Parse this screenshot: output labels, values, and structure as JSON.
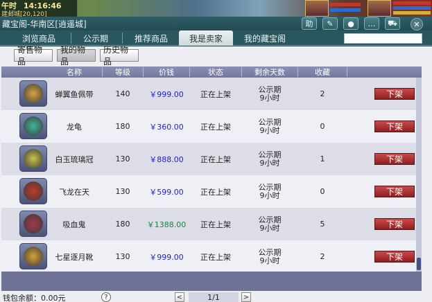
{
  "game_hud": {
    "time_prefix": "午时",
    "time": "14:16:46",
    "date_text": "建邺城[20,120]"
  },
  "window": {
    "title": "藏宝阁-华南区[逍遥城]",
    "title_buttons": [
      {
        "name": "assistant-button",
        "label": "助"
      },
      {
        "name": "edit-icon",
        "label": "✎"
      },
      {
        "name": "record-icon",
        "label": "●"
      },
      {
        "name": "chat-icon",
        "label": "…"
      },
      {
        "name": "cart-icon",
        "label": "⛟"
      }
    ],
    "close_label": "✕"
  },
  "tabs": [
    {
      "label": "浏览商品",
      "active": false
    },
    {
      "label": "公示期",
      "active": false
    },
    {
      "label": "推荐商品",
      "active": false
    },
    {
      "label": "我是卖家",
      "active": true
    },
    {
      "label": "我的藏宝阁",
      "active": false
    }
  ],
  "search": {
    "value": "",
    "placeholder": ""
  },
  "subtabs": [
    {
      "label": "寄售物品",
      "active": false
    },
    {
      "label": "我的物品",
      "active": true
    },
    {
      "label": "历史物品",
      "active": false
    }
  ],
  "table": {
    "columns": [
      "名称",
      "等级",
      "价钱",
      "状态",
      "剩余天数",
      "收藏"
    ],
    "rows": [
      {
        "name": "蝉翼鱼佩带",
        "level": "140",
        "price": "￥999.00",
        "status": "正在上架",
        "days_line1": "公示期",
        "days_line2": "9小时",
        "favorites": "2",
        "action": "下架",
        "icon": "belt-icon",
        "icon_color": "#d9a441"
      },
      {
        "name": "龙龟",
        "level": "180",
        "price": "￥360.00",
        "status": "正在上架",
        "days_line1": "公示期",
        "days_line2": "9小时",
        "favorites": "0",
        "action": "下架",
        "icon": "dragon-turtle-icon",
        "icon_color": "#3fb59a"
      },
      {
        "name": "白玉琉璃冠",
        "level": "130",
        "price": "￥888.00",
        "status": "正在上架",
        "days_line1": "公示期",
        "days_line2": "9小时",
        "favorites": "1",
        "action": "下架",
        "icon": "crown-icon",
        "icon_color": "#c8c24a"
      },
      {
        "name": "飞龙在天",
        "level": "130",
        "price": "￥599.00",
        "status": "正在上架",
        "days_line1": "公示期",
        "days_line2": "9小时",
        "favorites": "0",
        "action": "下架",
        "icon": "spear-icon",
        "icon_color": "#c0392b"
      },
      {
        "name": "吸血鬼",
        "level": "180",
        "price": "￥1388.00",
        "status": "正在上架",
        "days_line1": "公示期",
        "days_line2": "9小时",
        "favorites": "5",
        "action": "下架",
        "icon": "vampire-icon",
        "icon_color": "#a33a4a",
        "price_color": "green"
      },
      {
        "name": "七星逐月靴",
        "level": "130",
        "price": "￥999.00",
        "status": "正在上架",
        "days_line1": "公示期",
        "days_line2": "9小时",
        "favorites": "2",
        "action": "下架",
        "icon": "boots-icon",
        "icon_color": "#d8a13a"
      }
    ]
  },
  "footer": {
    "balance": "钱包余额：0.00元",
    "help_label": "?",
    "prev_label": "<",
    "page_text": "1/1",
    "next_label": ">"
  }
}
